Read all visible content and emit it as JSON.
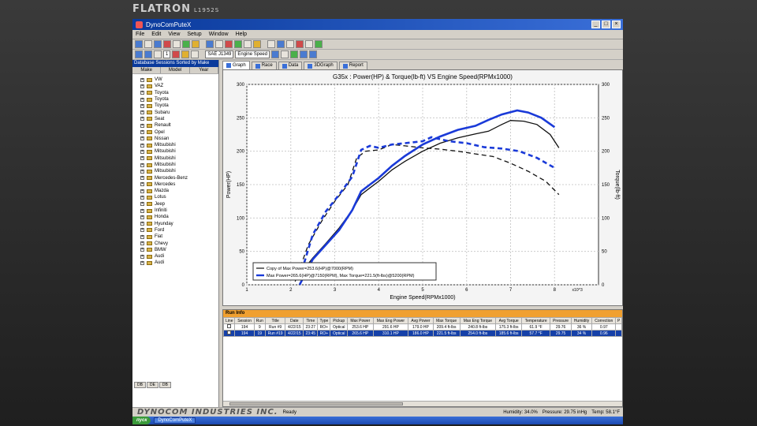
{
  "monitor": {
    "brand": "FLATRON",
    "model": "L1952S"
  },
  "window": {
    "title": "DynoComPuteX",
    "buttons": [
      "_",
      "□",
      "×"
    ]
  },
  "menu": [
    "File",
    "Edit",
    "View",
    "Setup",
    "Window",
    "Help"
  ],
  "toolbar": {
    "field1": "1",
    "field2": "SAE J1349",
    "field3": "Engine Speed"
  },
  "sidebar": {
    "header": "Database Sessions Sorted by Make",
    "cols": [
      "Make",
      "Model",
      "Year"
    ],
    "items": [
      "VW",
      "VAZ",
      "Toyota",
      "Toyota",
      "Toyota",
      "Subaru",
      "Seat",
      "Renault",
      "Opel",
      "Nissan",
      "Mitsubishi",
      "Mitsubishi",
      "Mitsubishi",
      "Mitsubishi",
      "Mitsubishi",
      "Mercedes-Benz",
      "Mercedes",
      "Mazda",
      "Lotus",
      "Jeep",
      "Infiniti",
      "Honda",
      "Hyunday",
      "Ford",
      "Fiat",
      "Chevy",
      "BMW",
      "Audi",
      "Audi"
    ]
  },
  "tabs": [
    "Graph",
    "Race",
    "Data",
    "3DGraph",
    "Report"
  ],
  "chart_data": {
    "type": "line",
    "title": "G35x : Power(HP) & Torque(lb-ft) VS Engine Speed(RPMx1000)",
    "xlabel": "Engine Speed(RPMx1000)",
    "ylabel": "Power(HP)",
    "y2label": "Torque(lb-ft)",
    "x_multiplier": "x10^3",
    "xlim": [
      1,
      9
    ],
    "ylim": [
      0,
      300
    ],
    "y2lim": [
      0,
      300
    ],
    "xticks": [
      "1",
      "2",
      "3",
      "4",
      "5",
      "6",
      "7",
      "8"
    ],
    "yticks": [
      "0",
      "50",
      "100",
      "150",
      "200",
      "250",
      "300"
    ],
    "grid": true,
    "legend_position": "bottom-left",
    "legend": [
      "Copy of Max Power=253.6(HP)@7000(RPM)",
      "Max Power=265.6(HP)@7150(RPM), Max Torque=221.5(ft-lbs)@5200(RPM)"
    ],
    "series": [
      {
        "name": "Copy of Max Power",
        "kind": "power",
        "color": "#111111",
        "dash": false,
        "x": [
          2.2,
          2.5,
          2.8,
          3.1,
          3.4,
          3.6,
          3.8,
          4.0,
          4.3,
          4.6,
          5.0,
          5.4,
          5.8,
          6.2,
          6.5,
          6.8,
          7.0,
          7.3,
          7.6,
          7.9,
          8.1
        ],
        "y": [
          15,
          40,
          62,
          85,
          112,
          135,
          145,
          155,
          172,
          185,
          200,
          212,
          220,
          226,
          230,
          240,
          246,
          245,
          240,
          225,
          205
        ]
      },
      {
        "name": "Copy of Max Power",
        "kind": "torque",
        "color": "#111111",
        "dash": true,
        "x": [
          2.1,
          2.4,
          2.7,
          3.0,
          3.3,
          3.5,
          3.7,
          4.0,
          4.3,
          4.6,
          5.0,
          5.4,
          5.8,
          6.2,
          6.6,
          7.0,
          7.4,
          7.8,
          8.1
        ],
        "y": [
          5,
          60,
          95,
          125,
          150,
          190,
          200,
          202,
          210,
          208,
          205,
          203,
          200,
          196,
          192,
          182,
          170,
          155,
          135
        ]
      },
      {
        "name": "Max Power",
        "kind": "power",
        "color": "#1a3ad8",
        "dash": false,
        "x": [
          2.2,
          2.5,
          2.8,
          3.1,
          3.4,
          3.6,
          3.8,
          4.0,
          4.3,
          4.6,
          5.0,
          5.4,
          5.8,
          6.2,
          6.5,
          6.8,
          7.15,
          7.4,
          7.7,
          8.0
        ],
        "y": [
          0,
          38,
          60,
          82,
          112,
          140,
          150,
          160,
          178,
          193,
          210,
          222,
          232,
          238,
          247,
          255,
          261,
          258,
          250,
          236
        ]
      },
      {
        "name": "Max Power",
        "kind": "torque",
        "color": "#1a3ad8",
        "dash": true,
        "x": [
          2.2,
          2.5,
          2.8,
          3.1,
          3.4,
          3.6,
          3.8,
          4.0,
          4.3,
          4.6,
          5.0,
          5.2,
          5.6,
          6.0,
          6.4,
          6.8,
          7.2,
          7.6,
          8.0
        ],
        "y": [
          10,
          75,
          110,
          135,
          162,
          202,
          208,
          205,
          210,
          212,
          215,
          221,
          215,
          212,
          206,
          204,
          200,
          190,
          175
        ]
      }
    ]
  },
  "run_info": {
    "title": "Run Info",
    "columns": [
      "Line",
      "Session",
      "Run",
      "Title",
      "Date",
      "Time",
      "Type",
      "Pickup",
      "Max Power",
      "Max Eng Power",
      "Avg Power",
      "Max Torque",
      "Max Eng Torque",
      "Avg Torque",
      "Temperature",
      "Pressure",
      "Humidity",
      "Correction",
      "P"
    ],
    "rows": [
      [
        "",
        "194",
        "9",
        "Run #9",
        "4/22/15",
        "23:27",
        "RO+",
        "Optical",
        "253.6 HP",
        "291.6 HP",
        "179.0 HP",
        "209.4 ft-lbs",
        "240.8 ft-lbs",
        "175.3 ft-lbs",
        "61.9 °F",
        "29.76",
        "36 %",
        "0.97",
        ""
      ],
      [
        "",
        "194",
        "19",
        "Run #19",
        "4/22/15",
        "23:45",
        "RO+",
        "Optical",
        "265.6 HP",
        "310.1 HP",
        "186.0 HP",
        "221.5 ft-lbs",
        "254.0 ft-lbs",
        "185.6 ft-lbs",
        "57.7 °F",
        "29.75",
        "34 %",
        "0.96",
        ""
      ]
    ]
  },
  "statusbar": {
    "logo": "DYNOCOM INDUSTRIES INC.",
    "ready": "Ready",
    "humidity": "Humidity: 34.0%",
    "pressure": "Pressure: 29.75 inHg",
    "temp": "Temp: 58.1°F"
  },
  "taskbar": {
    "start": "пуск",
    "task": "DynoComPuteX"
  }
}
